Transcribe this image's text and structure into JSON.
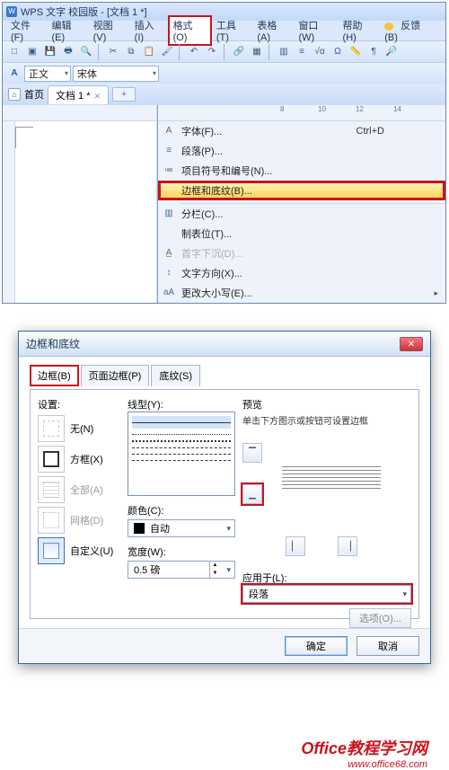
{
  "app": {
    "title": "WPS 文字 校园版 - [文档 1 *]",
    "icon_letter": "W"
  },
  "menubar": {
    "items": [
      "文件(F)",
      "编辑(E)",
      "视图(V)",
      "插入(I)",
      "格式(O)",
      "工具(T)",
      "表格(A)",
      "窗口(W)",
      "帮助(H)"
    ],
    "feedback_label": "反馈(B)",
    "highlight_index": 4
  },
  "toolbar1": {
    "icons": [
      "new",
      "open",
      "save",
      "print",
      "preview",
      "spell",
      "cut",
      "copy",
      "paste",
      "fmt",
      "undo",
      "redo",
      "link",
      "table",
      "align-l",
      "align-c",
      "math",
      "sym",
      "ruler",
      "para",
      "zoom",
      "help"
    ]
  },
  "toolbar2": {
    "style_label": "正文",
    "font_label": "宋体"
  },
  "tabs": {
    "home_label": "首页",
    "doc_label": "文档 1",
    "doc_dirty": "*"
  },
  "ruler_right_marks": [
    "8",
    "10",
    "12",
    "14"
  ],
  "dropdown": {
    "items": [
      {
        "label": "字体(F)...",
        "shortcut": "Ctrl+D",
        "ico": "A"
      },
      {
        "label": "段落(P)...",
        "ico": "≡"
      },
      {
        "label": "项目符号和编号(N)...",
        "ico": "≔"
      },
      {
        "label": "边框和底纹(B)...",
        "highlight": true
      },
      {
        "label": "分栏(C)...",
        "ico": "▥"
      },
      {
        "label": "制表位(T)...",
        "ico": ""
      },
      {
        "label": "首字下沉(D)...",
        "ico": "",
        "disabled": true
      },
      {
        "label": "文字方向(X)...",
        "ico": "↕A"
      },
      {
        "label": "更改大小写(E)...",
        "ico": "aA"
      }
    ]
  },
  "dialog": {
    "title": "边框和底纹",
    "tabs": [
      "边框(B)",
      "页面边框(P)",
      "底纹(S)"
    ],
    "active_tab": 0,
    "setting_label": "设置:",
    "settings": [
      {
        "label": "无(N)"
      },
      {
        "label": "方框(X)"
      },
      {
        "label": "全部(A)"
      },
      {
        "label": "网格(D)"
      },
      {
        "label": "自定义(U)"
      }
    ],
    "line_label": "线型(Y):",
    "color_label": "颜色(C):",
    "color_value": "自动",
    "width_label": "宽度(W):",
    "width_value": "0.5 磅",
    "preview_label": "预览",
    "preview_hint": "单击下方图示或按钮可设置边框",
    "apply_label": "应用于(L):",
    "apply_value": "段落",
    "options_label": "选项(O)...",
    "ok_label": "确定",
    "cancel_label": "取消"
  },
  "watermark": {
    "line1": "Office教程学习网",
    "line2": "www.office68.com"
  }
}
